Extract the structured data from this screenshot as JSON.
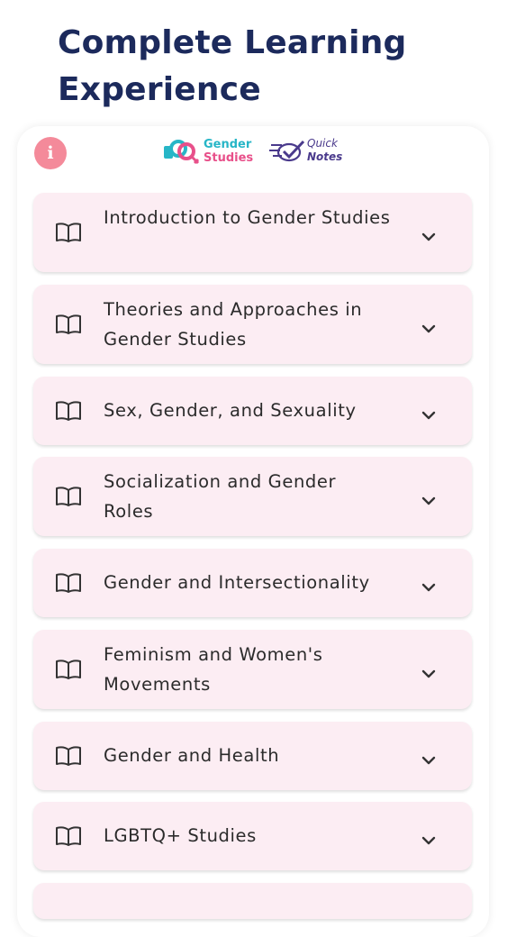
{
  "header": {
    "title": "Complete Learning Experience"
  },
  "info_button": {
    "label": "i"
  },
  "brands": {
    "gender": {
      "line1": "Gender",
      "line2": "Studies"
    },
    "notes": {
      "line1": "Quick",
      "line2": "Notes"
    }
  },
  "colors": {
    "title": "#1c2a5c",
    "card_bg": "#fcedf3",
    "info": "#f48a9a",
    "brand_teal": "#27b6c7",
    "brand_pink": "#e8508a",
    "notes_purple": "#4a3a8c"
  },
  "topics": [
    {
      "label": "Introduction to Gender Studies",
      "icon": "book-icon"
    },
    {
      "label": "Theories and Approaches in Gender Studies",
      "icon": "book-icon"
    },
    {
      "label": "Sex, Gender, and Sexuality",
      "icon": "book-icon"
    },
    {
      "label": "Socialization and Gender Roles",
      "icon": "book-icon"
    },
    {
      "label": "Gender and Intersectionality",
      "icon": "book-icon"
    },
    {
      "label": "Feminism and Women's Movements",
      "icon": "book-icon"
    },
    {
      "label": "Gender and Health",
      "icon": "book-icon"
    },
    {
      "label": "LGBTQ+ Studies",
      "icon": "book-icon"
    }
  ]
}
